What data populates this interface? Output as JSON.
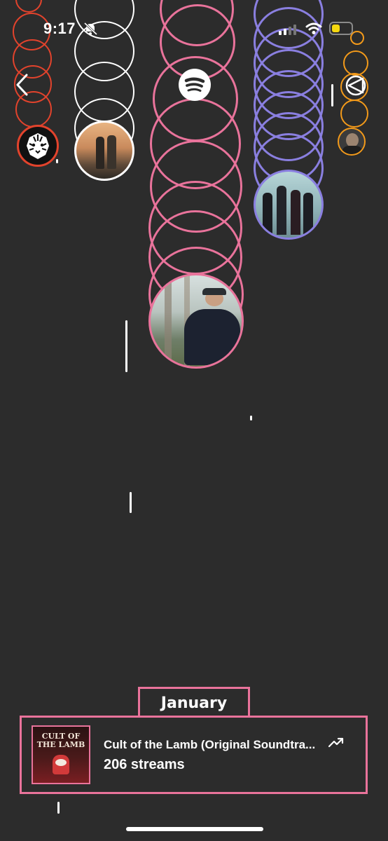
{
  "status_bar": {
    "time": "9:17",
    "icons": [
      "mute-bell-icon",
      "cellular-signal-icon",
      "wifi-icon",
      "battery-low-icon"
    ]
  },
  "nav": {
    "back_icon": "chevron-left-icon",
    "share_icon": "share-icon"
  },
  "streams_card": {
    "month": "January",
    "track_title": "Cult of the Lamb (Original Soundtra...",
    "streams": "206 streams",
    "trend_icon": "trending-up-icon",
    "album_art_text": "CULT OF THE LAMB"
  },
  "colors": {
    "background": "#2c2c2c",
    "red_artist": "#e2432c",
    "white_artist": "#ffffff",
    "pink_artist": "#e9739b",
    "purple_artist": "#8a7fe0",
    "orange_artist": "#f39a1a",
    "battery": "#f5d80f"
  }
}
